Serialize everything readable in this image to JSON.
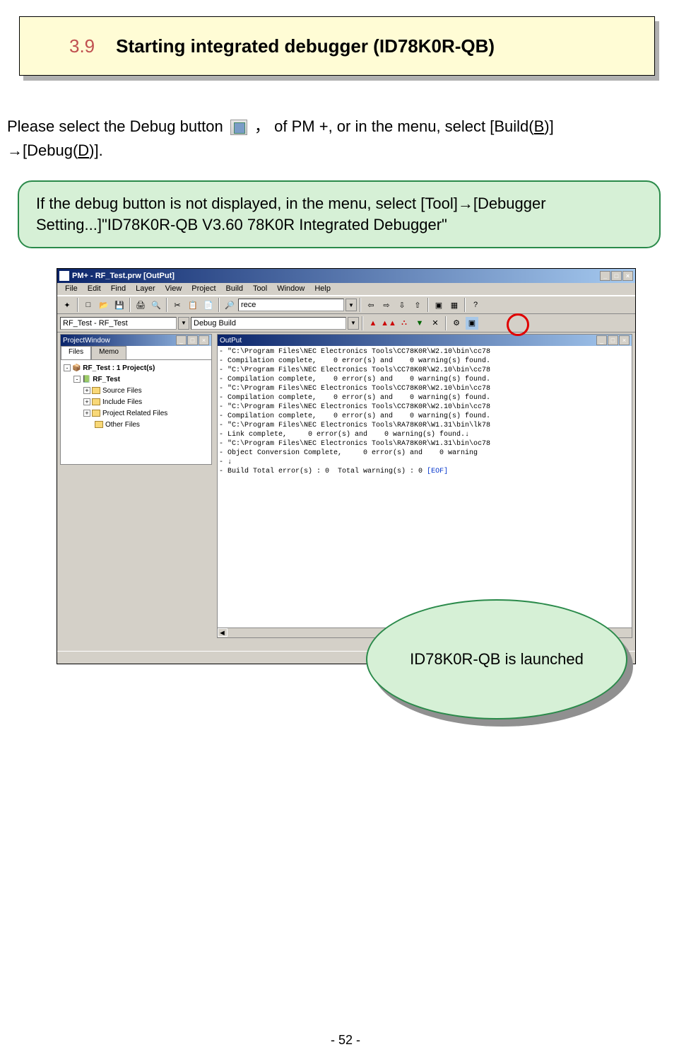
{
  "heading": {
    "number": "3.9",
    "title": "Starting integrated debugger (ID78K0R-QB)"
  },
  "intro": {
    "part1": "Please select the Debug button ",
    "part2": " ，",
    "part3": "of PM +, or in the menu, select [Build(",
    "build_key": "B",
    "part4": ")]",
    "part5": "→[Debug(",
    "debug_key": "D",
    "part6": ")]."
  },
  "note": "If the debug button is not displayed, in the menu, select [Tool]→[Debugger Setting...]\"ID78K0R-QB V3.60 78K0R Integrated Debugger\"",
  "pm_window": {
    "title": "PM+ - RF_Test.prw [OutPut]",
    "menu": [
      "File",
      "Edit",
      "Find",
      "Layer",
      "View",
      "Project",
      "Build",
      "Tool",
      "Window",
      "Help"
    ],
    "search_value": "rece",
    "project_combo": "RF_Test - RF_Test",
    "build_combo": "Debug Build",
    "project_win_title": "ProjectWindow",
    "tabs": [
      "Files",
      "Memo"
    ],
    "tree": {
      "root": "RF_Test : 1 Project(s)",
      "project": "RF_Test",
      "folders": [
        "Source Files",
        "Include Files",
        "Project Related Files",
        "Other Files"
      ]
    },
    "output_title": "OutPut",
    "output_lines": [
      "- \"C:\\Program Files\\NEC Electronics Tools\\CC78K0R\\W2.10\\bin\\cc78",
      "- Compilation complete,    0 error(s) and    0 warning(s) found.",
      "- \"C:\\Program Files\\NEC Electronics Tools\\CC78K0R\\W2.10\\bin\\cc78",
      "- Compilation complete,    0 error(s) and    0 warning(s) found.",
      "- \"C:\\Program Files\\NEC Electronics Tools\\CC78K0R\\W2.10\\bin\\cc78",
      "- Compilation complete,    0 error(s) and    0 warning(s) found.",
      "- \"C:\\Program Files\\NEC Electronics Tools\\CC78K0R\\W2.10\\bin\\cc78",
      "- Compilation complete,    0 error(s) and    0 warning(s) found.",
      "- \"C:\\Program Files\\NEC Electronics Tools\\RA78K0R\\W1.31\\bin\\lk78",
      "- Link complete,     0 error(s) and    0 warning(s) found.↓",
      "- \"C:\\Program Files\\NEC Electronics Tools\\RA78K0R\\W1.31\\bin\\oc78",
      "- Object Conversion Complete,     0 error(s) and    0 warning",
      "- ↓",
      "- Build Total error(s) : 0  Total warning(s) : 0 "
    ],
    "output_eof": "[EOF]"
  },
  "callout": "ID78K0R-QB is launched",
  "page_number": "- 52 -"
}
